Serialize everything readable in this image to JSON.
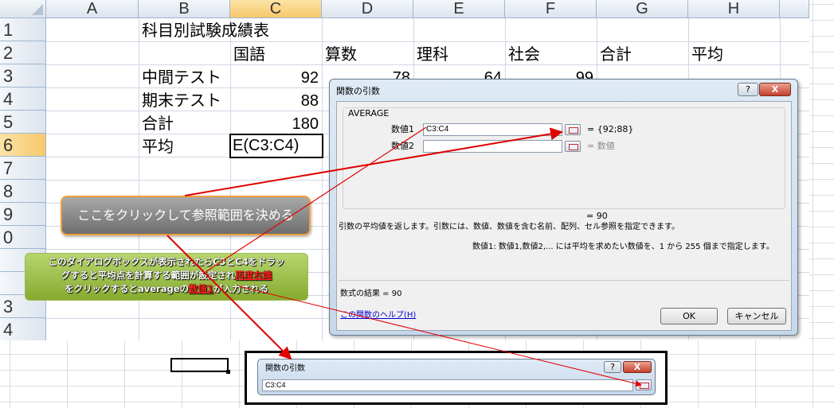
{
  "spreadsheet": {
    "columns": [
      "A",
      "B",
      "C",
      "D",
      "E",
      "F",
      "G",
      "H"
    ],
    "rows": [
      "1",
      "2",
      "3",
      "4",
      "5",
      "6",
      "7",
      "8",
      "9",
      "0",
      "",
      "3",
      "4"
    ],
    "title": "科目別試験成績表",
    "subject_headers": [
      "国語",
      "算数",
      "理科",
      "社会",
      "合計",
      "平均"
    ],
    "row_labels": [
      "中間テスト",
      "期末テスト",
      "合計",
      "平均"
    ],
    "c_values": [
      "92",
      "88",
      "180"
    ],
    "active_cell_formula": "E(C3:C4)",
    "partial_values": [
      "78",
      "64",
      "99"
    ]
  },
  "callouts": {
    "click_here": "ここをクリックして参照範囲を決める",
    "instruction_line1": "このダイアログボックスが表示されたらC3とC4をドラッ",
    "instruction_line2a": "グすると平均点を計算する範囲が設定され",
    "instruction_highlight1": "再度右端",
    "instruction_line3a": "をクリックするとaverageの",
    "instruction_highlight2": "数値1",
    "instruction_line3b": "が入力される"
  },
  "dialog": {
    "title": "関数の引数",
    "help_button": "?",
    "close_button": "X",
    "function_name": "AVERAGE",
    "arg1_label": "数値1",
    "arg1_value": "C3:C4",
    "arg1_result": "= {92;88}",
    "arg2_label": "数値2",
    "arg2_value": "",
    "arg2_result": "= 数値",
    "total_result": "= 90",
    "description": "引数の平均値を返します。引数には、数値、数値を含む名前、配列、セル参照を指定できます。",
    "arg_help": "数値1:  数値1,数値2,... には平均を求めたい数値を、1 から 255 個まで指定します。",
    "formula_result": "数式の結果 =  90",
    "help_link": "この関数のヘルプ(H)",
    "ok_button": "OK",
    "cancel_button": "キャンセル"
  },
  "mini_dialog": {
    "title": "関数の引数",
    "help_button": "?",
    "close_button": "X",
    "value": "C3:C4"
  },
  "colors": {
    "arrow": "#e00000",
    "selected_header": "#f7c86b",
    "callout_gray": "#8a8a8a",
    "callout_green": "#9bbb59"
  }
}
